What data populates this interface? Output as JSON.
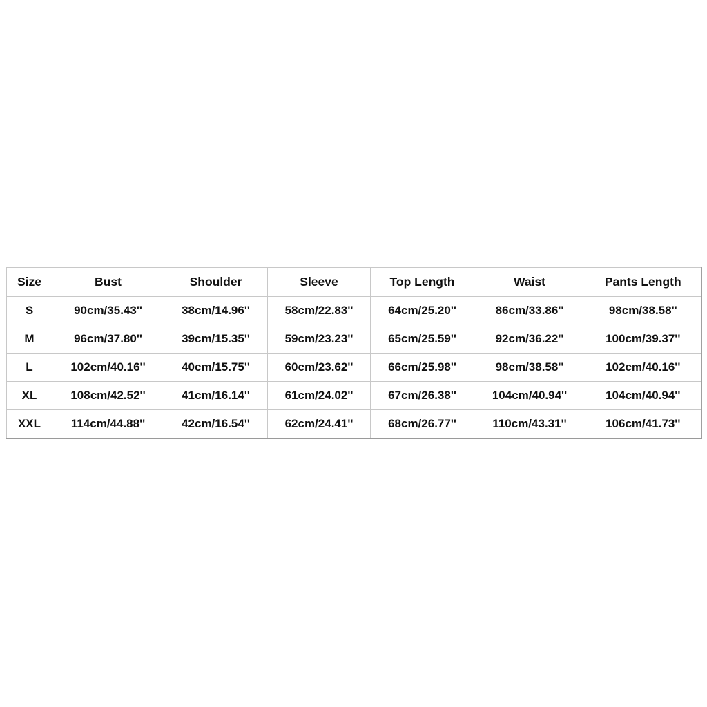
{
  "size_chart": {
    "headers": [
      "Size",
      "Bust",
      "Shoulder",
      "Sleeve",
      "Top Length",
      "Waist",
      "Pants Length"
    ],
    "rows": [
      [
        "S",
        "90cm/35.43''",
        "38cm/14.96''",
        "58cm/22.83''",
        "64cm/25.20''",
        "86cm/33.86''",
        "98cm/38.58''"
      ],
      [
        "M",
        "96cm/37.80''",
        "39cm/15.35''",
        "59cm/23.23''",
        "65cm/25.59''",
        "92cm/36.22''",
        "100cm/39.37''"
      ],
      [
        "L",
        "102cm/40.16''",
        "40cm/15.75''",
        "60cm/23.62''",
        "66cm/25.98''",
        "98cm/38.58''",
        "102cm/40.16''"
      ],
      [
        "XL",
        "108cm/42.52''",
        "41cm/16.14''",
        "61cm/24.02''",
        "67cm/26.38''",
        "104cm/40.94''",
        "104cm/40.94''"
      ],
      [
        "XXL",
        "114cm/44.88''",
        "42cm/16.54''",
        "62cm/24.41''",
        "68cm/26.77''",
        "110cm/43.31''",
        "106cm/41.73''"
      ]
    ]
  }
}
